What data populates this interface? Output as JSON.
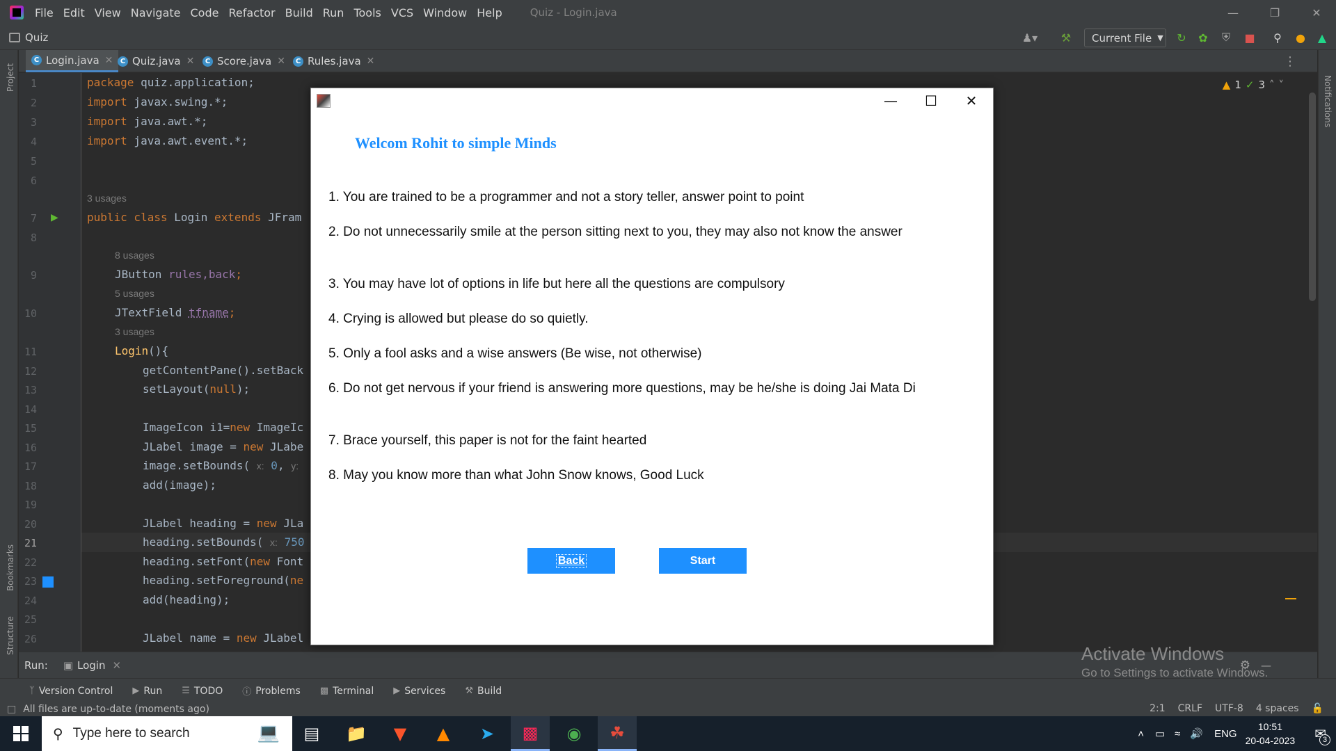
{
  "menubar": {
    "items": [
      "File",
      "Edit",
      "View",
      "Navigate",
      "Code",
      "Refactor",
      "Build",
      "Run",
      "Tools",
      "VCS",
      "Window",
      "Help"
    ],
    "window_title": "Quiz - Login.java"
  },
  "toolbar": {
    "project_name": "Quiz",
    "run_config": "Current File"
  },
  "left_strip": {
    "project": "Project",
    "bookmarks": "Bookmarks",
    "structure": "Structure"
  },
  "right_strip": {
    "notifications": "Notifications"
  },
  "tabs": [
    {
      "label": "Login.java",
      "active": true
    },
    {
      "label": "Quiz.java",
      "active": false
    },
    {
      "label": "Score.java",
      "active": false
    },
    {
      "label": "Rules.java",
      "active": false
    }
  ],
  "editor": {
    "warnings": "1",
    "checks": "3",
    "line_numbers": [
      "1",
      "2",
      "3",
      "4",
      "5",
      "6",
      "7",
      "8",
      "9",
      "10",
      "11",
      "12",
      "13",
      "14",
      "15",
      "16",
      "17",
      "18",
      "19",
      "20",
      "21",
      "22",
      "23",
      "24",
      "25",
      "26"
    ],
    "usage_hints": {
      "class": "3 usages",
      "buttons": "8 usages",
      "textfield": "5 usages",
      "ctor": "3 usages"
    },
    "hint_x": "x:",
    "hint_y": "y:",
    "lines": {
      "l1a": "package",
      "l1b": " quiz.application;",
      "l2a": "import",
      "l2b": " javax.swing.*;",
      "l3a": "import",
      "l3b": " java.awt.*;",
      "l4a": "import",
      "l4b": " java.awt.event.*;",
      "l7a": "public class",
      "l7b": " Login ",
      "l7c": "extends",
      "l7d": " JFram",
      "l9a": "JButton ",
      "l9b": "rules,back",
      "l9c": ";",
      "l10a": "JTextField ",
      "l10b": "tfname",
      "l10c": ";",
      "l11a": "Login",
      "l11b": "(){",
      "l12": "getContentPane().setBack",
      "l13a": "setLayout(",
      "l13b": "null",
      "l13c": ");",
      "l15a": "ImageIcon i1=",
      "l15b": "new",
      "l15c": " ImageIc",
      "l16a": "JLabel image = ",
      "l16b": "new",
      "l16c": " JLabe",
      "l17a": "image.setBounds( ",
      "l17b": "0",
      "l17c": ", ",
      "l18": "add(image);",
      "l20a": "JLabel heading = ",
      "l20b": "new",
      "l20c": " JLa",
      "l21a": "heading.setBounds( ",
      "l21b": "750",
      "l22a": "heading.setFont(",
      "l22b": "new",
      "l22c": " Font",
      "l23a": "heading.setForeground(",
      "l23b": "ne",
      "l24": "add(heading);",
      "l26a": "JLabel name = ",
      "l26b": "new",
      "l26c": " JLabel"
    }
  },
  "run_panel": {
    "label": "Run:",
    "tab": "Login"
  },
  "bottom_tools": [
    "Version Control",
    "Run",
    "TODO",
    "Problems",
    "Terminal",
    "Services",
    "Build"
  ],
  "statusbar": {
    "message": "All files are up-to-date (moments ago)",
    "position": "2:1",
    "line_sep": "CRLF",
    "encoding": "UTF-8",
    "indent": "4 spaces"
  },
  "watermark": {
    "line1": "Activate Windows",
    "line2": "Go to Settings to activate Windows."
  },
  "dialog": {
    "heading": "Welcom Rohit to simple Minds",
    "rules": [
      "1. You are trained to be a programmer and not a story teller, answer point to point",
      "2. Do not unnecessarily smile at the person sitting next to you, they may also not know the answer",
      "3. You may have lot of options in life but here all the questions are compulsory",
      "4. Crying is allowed but please do so quietly.",
      "5. Only a fool asks and a wise answers (Be wise, not otherwise)",
      "6. Do not get nervous if your friend is answering more questions, may be he/she is doing Jai Mata Di",
      "7. Brace yourself, this paper is not for the faint hearted",
      "8. May you know more than what John Snow knows, Good Luck"
    ],
    "back_label": "Back",
    "start_label": "Start",
    "accent": "#1e90ff"
  },
  "taskbar": {
    "search_placeholder": "Type here to search",
    "lang": "ENG",
    "time": "10:51",
    "date": "20-04-2023",
    "notif_count": "3"
  }
}
